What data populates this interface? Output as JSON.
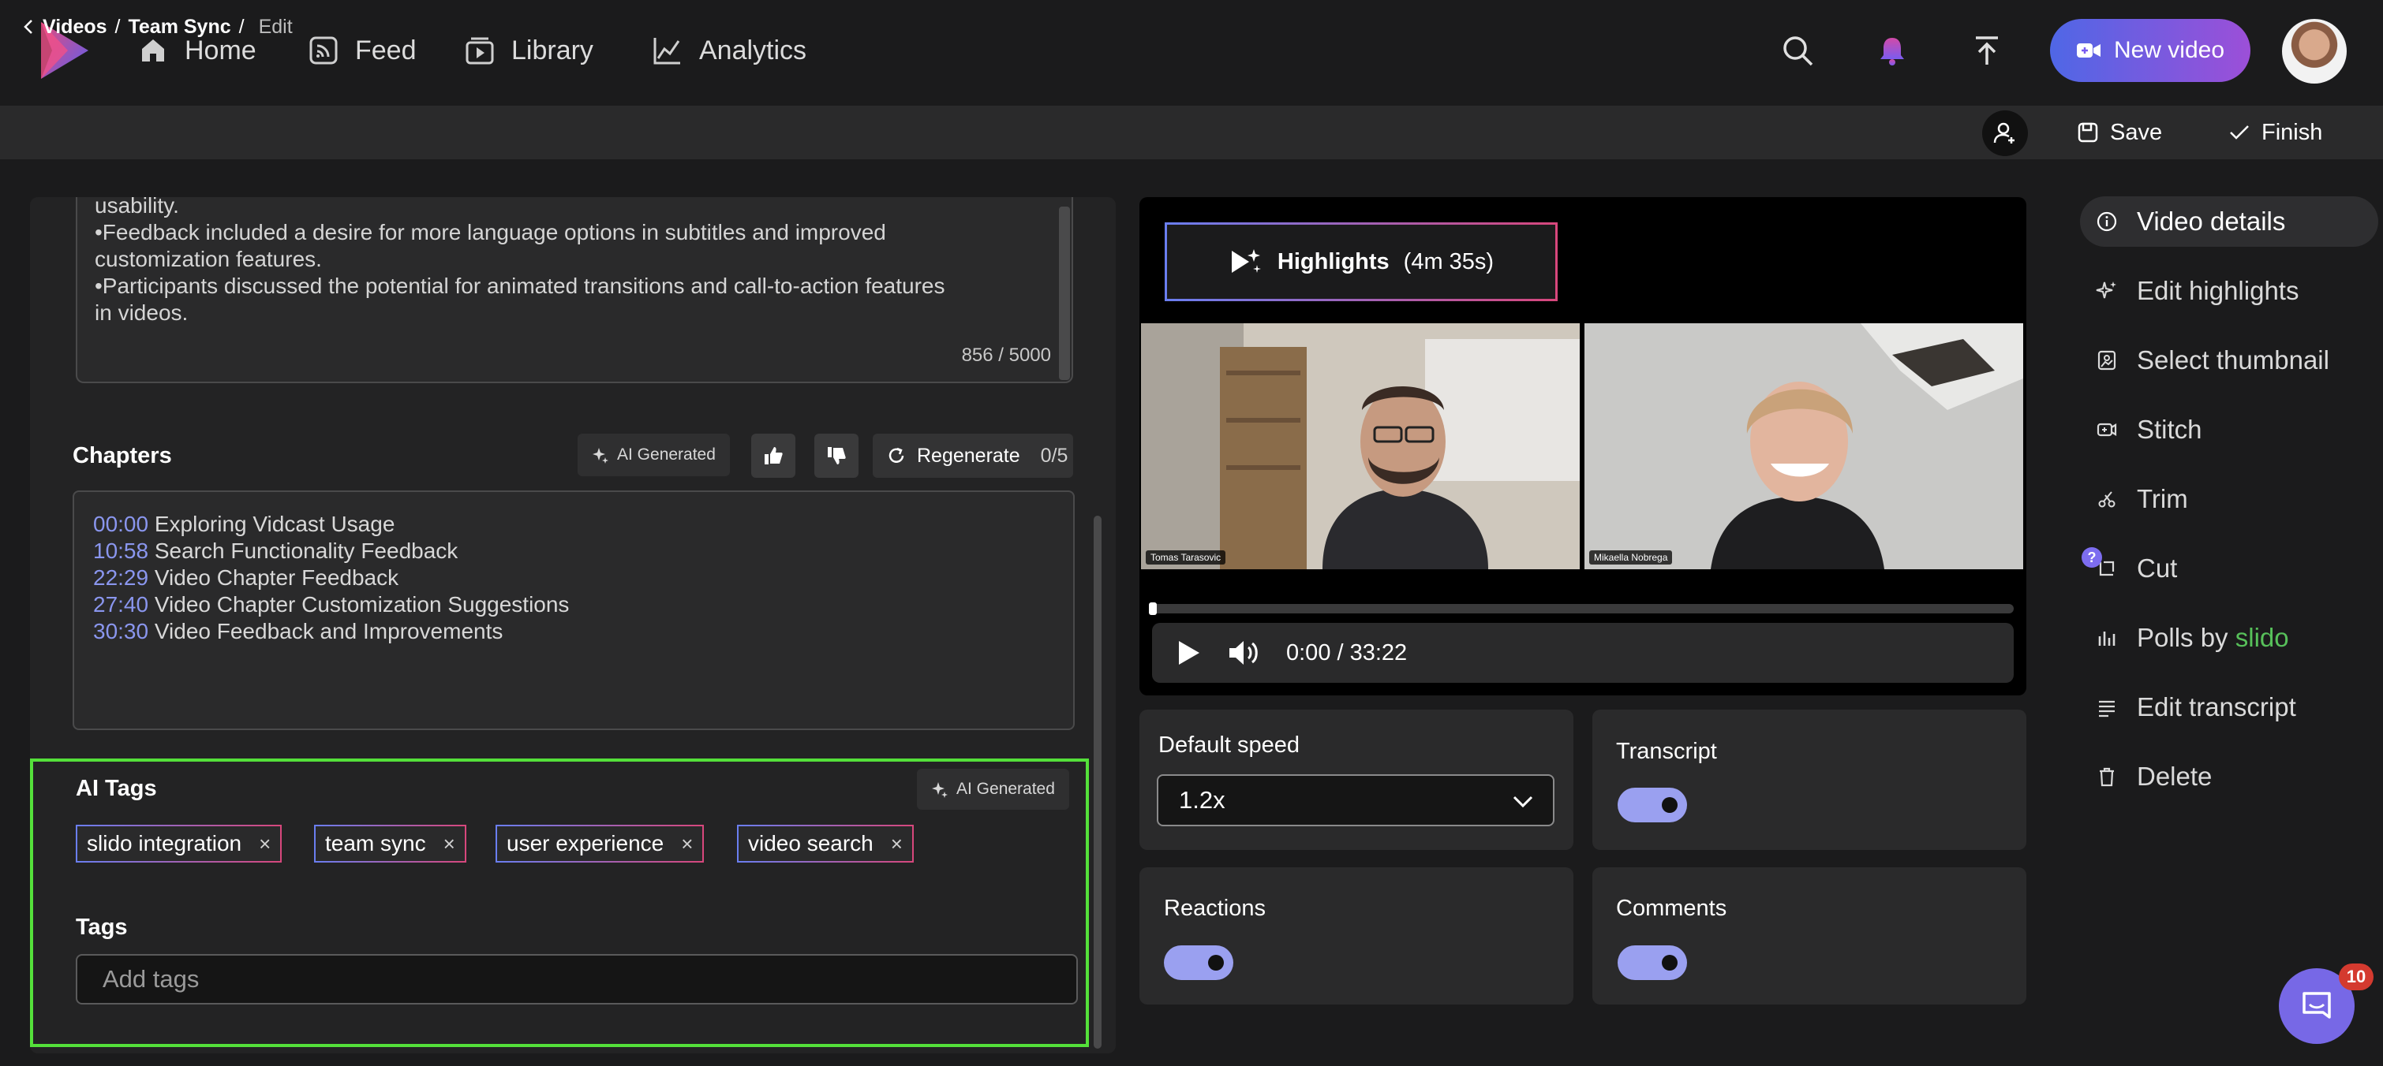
{
  "nav": {
    "items": [
      {
        "label": "Home",
        "icon": "home-icon"
      },
      {
        "label": "Feed",
        "icon": "feed-icon"
      },
      {
        "label": "Library",
        "icon": "library-icon"
      },
      {
        "label": "Analytics",
        "icon": "analytics-icon"
      }
    ],
    "new_video_label": "New video"
  },
  "breadcrumb": {
    "videos": "Videos",
    "team_sync": "Team Sync",
    "current": "Edit",
    "separator": "/"
  },
  "actions": {
    "save_label": "Save",
    "finish_label": "Finish"
  },
  "summary": {
    "lines": [
      "usability.",
      "•Feedback included a desire for more language options in subtitles and improved",
      "customization features.",
      "•Participants discussed the potential for animated transitions and call-to-action features",
      "in videos."
    ],
    "counter": "856 / 5000"
  },
  "chapters": {
    "title": "Chapters",
    "ai_generated_label": "AI Generated",
    "regenerate_label": "Regenerate",
    "regenerate_count": "0/5",
    "items": [
      {
        "time": "00:00",
        "title": "Exploring Vidcast Usage"
      },
      {
        "time": "10:58",
        "title": "Search Functionality Feedback"
      },
      {
        "time": "22:29",
        "title": "Video Chapter Feedback"
      },
      {
        "time": "27:40",
        "title": "Video Chapter Customization Suggestions"
      },
      {
        "time": "30:30",
        "title": "Video Feedback and Improvements"
      }
    ]
  },
  "ai_tags": {
    "title": "AI Tags",
    "ai_generated_label": "AI Generated",
    "chips": [
      "slido integration",
      "team sync",
      "user experience",
      "video search"
    ],
    "remove_glyph": "×"
  },
  "tags": {
    "title": "Tags",
    "placeholder": "Add tags"
  },
  "video": {
    "highlights_label": "Highlights",
    "highlights_duration": "(4m 35s)",
    "participants": [
      "Tomas Tarasovic",
      "Mikaella Nobrega"
    ],
    "time": "0:00 / 33:22",
    "progress": 0
  },
  "settings": {
    "default_speed_label": "Default speed",
    "default_speed_value": "1.2x",
    "transcript_label": "Transcript",
    "transcript_on": true,
    "reactions_label": "Reactions",
    "reactions_on": true,
    "comments_label": "Comments",
    "comments_on": true
  },
  "side_menu": {
    "items": [
      {
        "label": "Video details",
        "icon": "info-icon",
        "active": true
      },
      {
        "label": "Edit highlights",
        "icon": "sparkle-icon"
      },
      {
        "label": "Select thumbnail",
        "icon": "thumbnail-icon"
      },
      {
        "label": "Stitch",
        "icon": "stitch-icon"
      },
      {
        "label": "Trim",
        "icon": "scissors-icon"
      },
      {
        "label": "Cut",
        "icon": "cut-icon"
      },
      {
        "label": "Polls by",
        "suffix": "slido",
        "icon": "polls-icon"
      },
      {
        "label": "Edit transcript",
        "icon": "transcript-icon"
      },
      {
        "label": "Delete",
        "icon": "trash-icon"
      }
    ],
    "help_glyph": "?"
  },
  "chat": {
    "badge": "10"
  },
  "colors": {
    "accent": "#9aa0f0",
    "brand_gradient_start": "#4f67e6",
    "brand_gradient_end": "#9c4fd8",
    "slido": "#57c05a",
    "highlight_frame": "#54e03a",
    "timestamp": "#8a96ee"
  }
}
